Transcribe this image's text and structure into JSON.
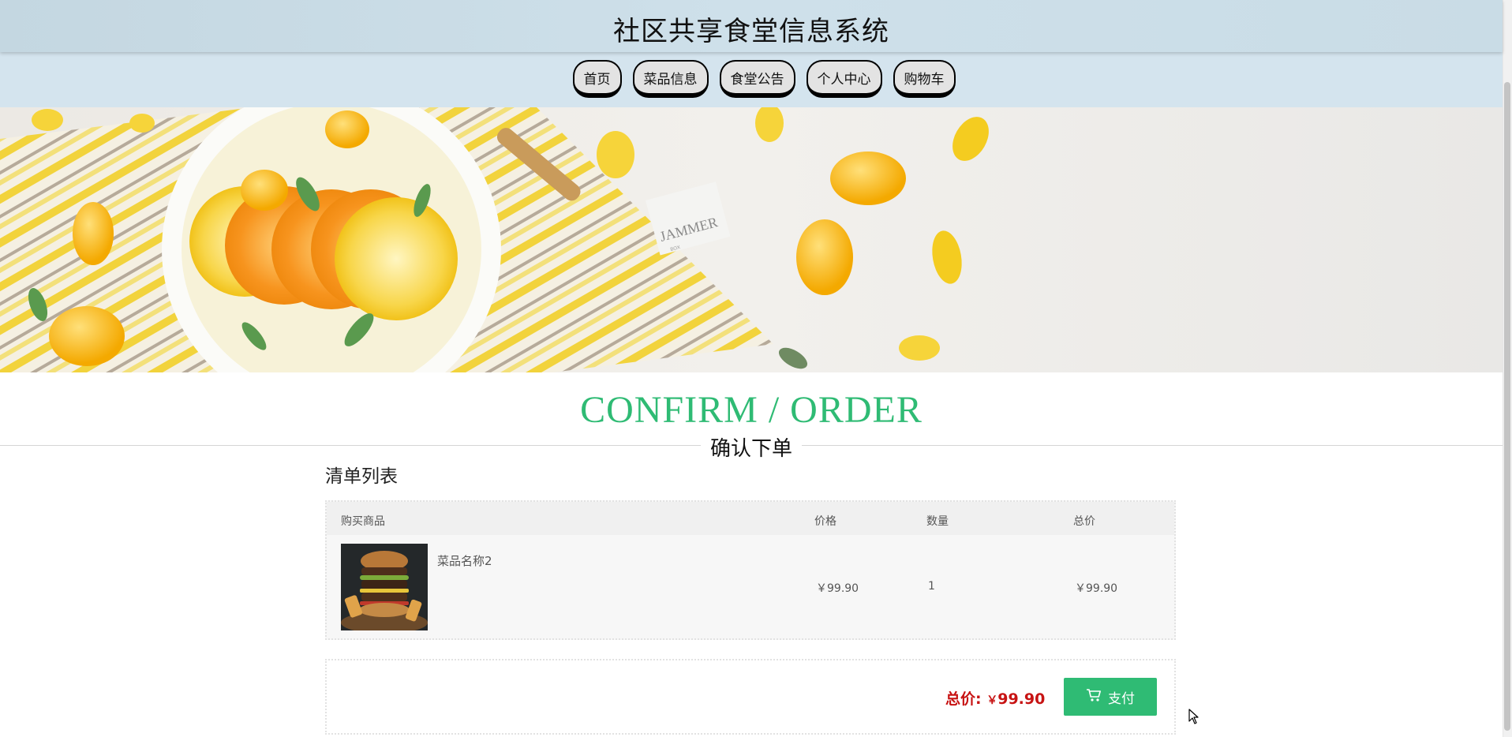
{
  "site": {
    "title": "社区共享食堂信息系统"
  },
  "nav": {
    "items": [
      "首页",
      "菜品信息",
      "食堂公告",
      "个人中心",
      "购物车"
    ]
  },
  "banner": {
    "label": "JAMMER",
    "label_small": "BOX"
  },
  "confirm": {
    "heading": "CONFIRM / ORDER",
    "subheading": "确认下单"
  },
  "list": {
    "title": "清单列表"
  },
  "table": {
    "headers": {
      "product": "购买商品",
      "price": "价格",
      "quantity": "数量",
      "total": "总价"
    },
    "rows": [
      {
        "name": "菜品名称2",
        "price": "￥99.90",
        "quantity": "1",
        "total": "￥99.90"
      }
    ]
  },
  "summary": {
    "total_label": "总价:",
    "total_currency": "￥",
    "total_value": "99.90",
    "pay_label": "支付"
  },
  "colors": {
    "accent": "#2fbb74",
    "price_red": "#c71313",
    "header_bg": "#c9dce6",
    "nav_bg": "#d4e4ee"
  }
}
